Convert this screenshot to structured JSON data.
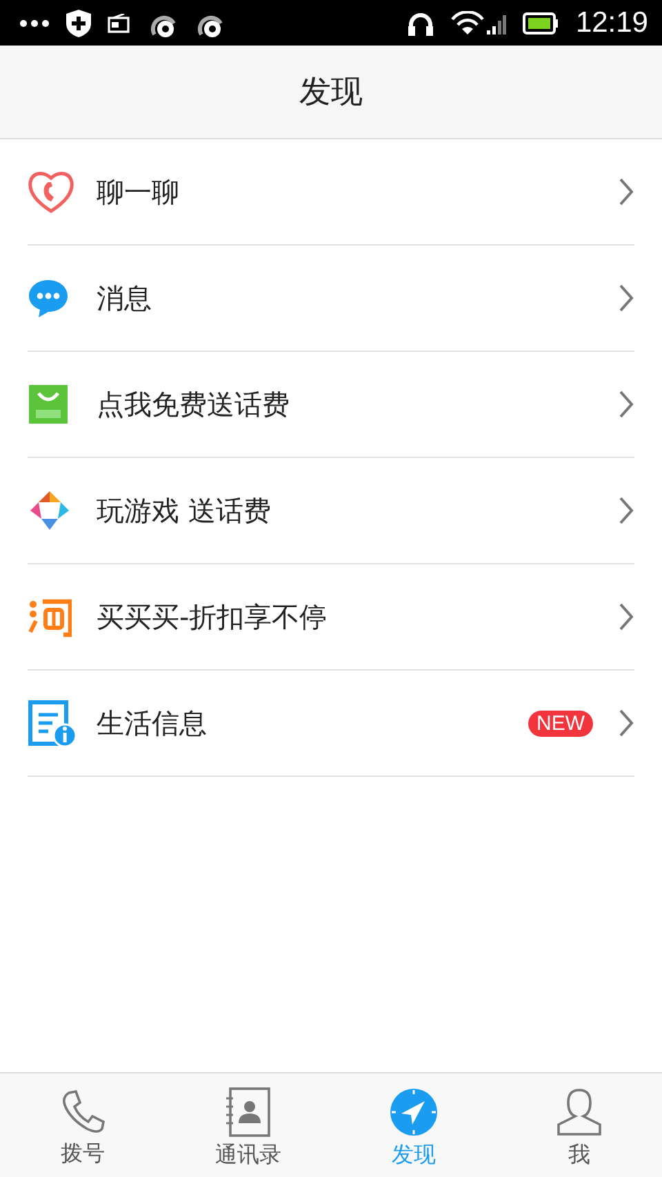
{
  "status_bar": {
    "time": "12:19"
  },
  "header": {
    "title": "发现"
  },
  "items": [
    {
      "kind": "heart-phone",
      "label": "聊一聊"
    },
    {
      "kind": "chat",
      "label": "消息"
    },
    {
      "kind": "app",
      "label": "点我免费送话费"
    },
    {
      "kind": "game",
      "label": "玩游戏 送话费"
    },
    {
      "kind": "shop",
      "label": "买买买-折扣享不停"
    },
    {
      "kind": "info",
      "label": "生活信息",
      "badge": "NEW"
    }
  ],
  "tabs": [
    {
      "kind": "phone",
      "label": "拨号",
      "selected": false
    },
    {
      "kind": "contacts",
      "label": "通讯录",
      "selected": false
    },
    {
      "kind": "compass",
      "label": "发现",
      "selected": true
    },
    {
      "kind": "person",
      "label": "我",
      "selected": false
    }
  ]
}
